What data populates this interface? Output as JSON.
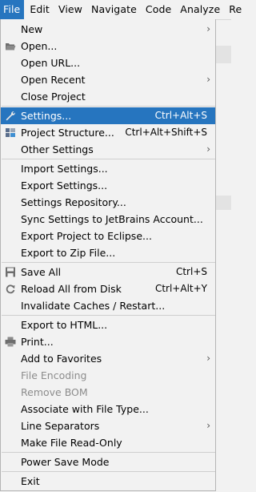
{
  "menubar": {
    "items": [
      {
        "label": "File",
        "active": true
      },
      {
        "label": "Edit"
      },
      {
        "label": "View"
      },
      {
        "label": "Navigate"
      },
      {
        "label": "Code"
      },
      {
        "label": "Analyze"
      },
      {
        "label": "Re"
      }
    ]
  },
  "file_menu": {
    "items": [
      {
        "label": "New",
        "submenu_arrow": "›"
      },
      {
        "label": "Open...",
        "icon": "folder-icon"
      },
      {
        "label": "Open URL..."
      },
      {
        "label": "Open Recent",
        "submenu_arrow": "›"
      },
      {
        "label": "Close Project"
      },
      {
        "label": "Settings...",
        "shortcut": "Ctrl+Alt+S",
        "icon": "wrench-icon",
        "selected": true
      },
      {
        "label": "Project Structure...",
        "shortcut": "Ctrl+Alt+Shift+S",
        "icon": "project-structure-icon"
      },
      {
        "label": "Other Settings",
        "submenu_arrow": "›"
      },
      {
        "label": "Import Settings..."
      },
      {
        "label": "Export Settings..."
      },
      {
        "label": "Settings Repository..."
      },
      {
        "label": "Sync Settings to JetBrains Account..."
      },
      {
        "label": "Export Project to Eclipse..."
      },
      {
        "label": "Export to Zip File..."
      },
      {
        "label": "Save All",
        "shortcut": "Ctrl+S",
        "icon": "save-icon"
      },
      {
        "label": "Reload All from Disk",
        "shortcut": "Ctrl+Alt+Y",
        "icon": "reload-icon"
      },
      {
        "label": "Invalidate Caches / Restart..."
      },
      {
        "label": "Export to HTML..."
      },
      {
        "label": "Print...",
        "icon": "printer-icon"
      },
      {
        "label": "Add to Favorites",
        "submenu_arrow": "›"
      },
      {
        "label": "File Encoding",
        "disabled": true
      },
      {
        "label": "Remove BOM",
        "disabled": true
      },
      {
        "label": "Associate with File Type..."
      },
      {
        "label": "Line Separators",
        "submenu_arrow": "›"
      },
      {
        "label": "Make File Read-Only"
      },
      {
        "label": "Power Save Mode"
      },
      {
        "label": "Exit"
      }
    ]
  },
  "colors": {
    "selection": "#2675bf",
    "menu_background": "#f2f2f2",
    "disabled_text": "#8c8c8c"
  }
}
